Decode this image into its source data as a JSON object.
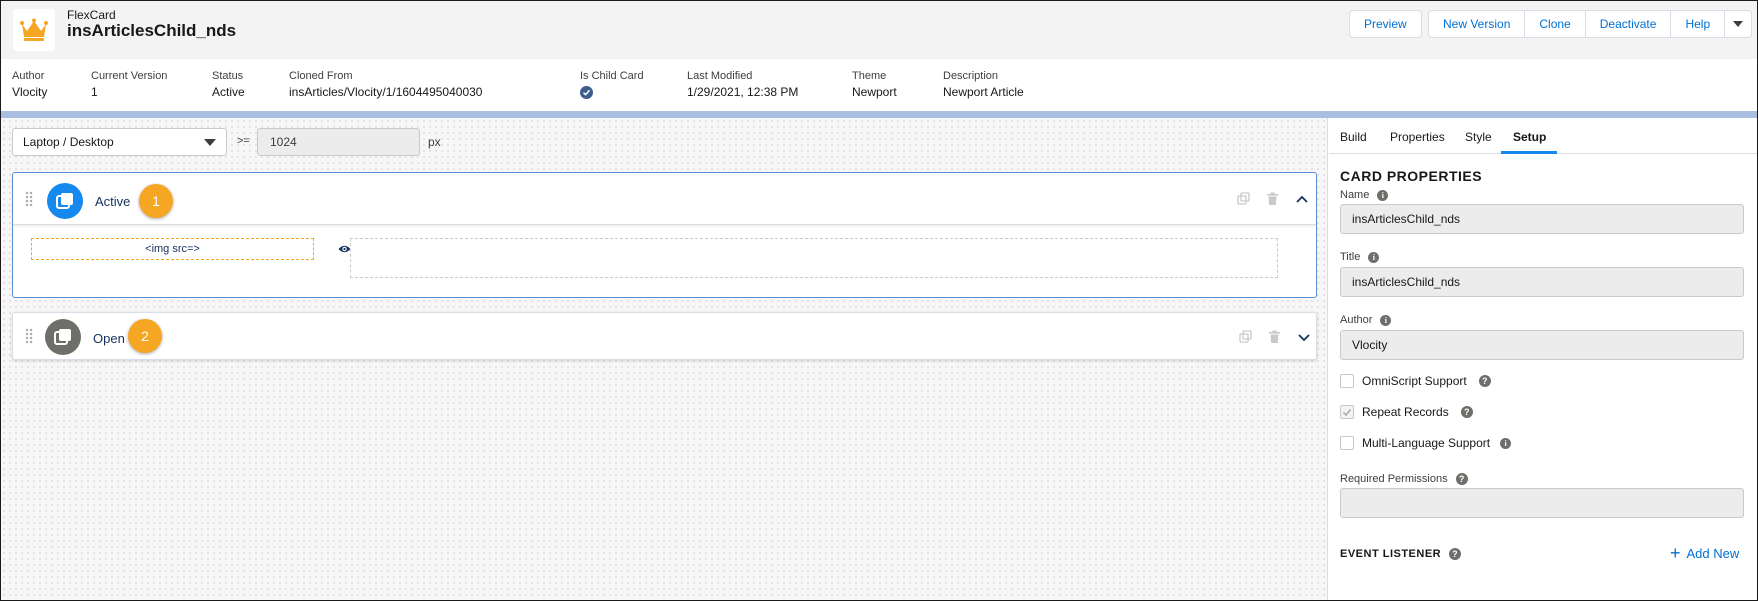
{
  "header": {
    "object_label": "FlexCard",
    "title": "insArticlesChild_nds",
    "icon": "crown-icon",
    "buttons": {
      "preview": "Preview",
      "new_version": "New Version",
      "clone": "Clone",
      "deactivate": "Deactivate",
      "help": "Help"
    }
  },
  "meta": {
    "author_label": "Author",
    "author": "Vlocity",
    "version_label": "Current Version",
    "version": "1",
    "status_label": "Status",
    "status": "Active",
    "cloned_label": "Cloned From",
    "cloned": "insArticles/Vlocity/1/1604495040030",
    "child_label": "Is Child Card",
    "modified_label": "Last Modified",
    "modified": "1/29/2021, 12:38 PM",
    "theme_label": "Theme",
    "theme": "Newport",
    "description_label": "Description",
    "description": "Newport Article"
  },
  "canvas": {
    "device": "Laptop / Desktop",
    "gte": ">=",
    "width_value": "1024",
    "unit": "px",
    "states": [
      {
        "name": "Active",
        "badge": "1",
        "icon_color": "#1589ee",
        "expanded": true
      },
      {
        "name": "Open",
        "badge": "2",
        "icon_color": "#706e6b",
        "expanded": false
      }
    ],
    "element_label": "<img src=>"
  },
  "panel": {
    "tabs": [
      "Build",
      "Properties",
      "Style",
      "Setup"
    ],
    "selected_tab": "Setup",
    "section_title": "CARD PROPERTIES",
    "name_label": "Name",
    "name_value": "insArticlesChild_nds",
    "title_label": "Title",
    "title_value": "insArticlesChild_nds",
    "author_label": "Author",
    "author_value": "Vlocity",
    "omniscript_label": "OmniScript Support",
    "omniscript_checked": false,
    "repeat_label": "Repeat Records",
    "repeat_checked": true,
    "multilang_label": "Multi-Language Support",
    "multilang_checked": false,
    "permissions_label": "Required Permissions",
    "permissions_value": "",
    "event_title": "EVENT LISTENER",
    "add_new": "Add New"
  },
  "colors": {
    "accent": "#0070d2",
    "badge": "#f5a623",
    "active_border": "#5a8fd1"
  }
}
